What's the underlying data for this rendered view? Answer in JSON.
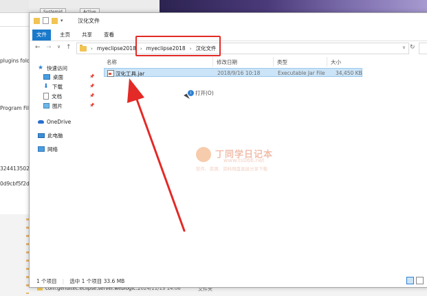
{
  "background": {
    "left_texts": [
      "plugins fold",
      "Program Fil",
      "3244135027",
      "0d9cbf5f2d"
    ],
    "top_buttons": [
      "Systemid",
      "Active"
    ],
    "bottom_row": {
      "name": "com.genuitec.eclipse.server.weblogic...",
      "date": "2024/11/13 14:06",
      "type": "文件夹"
    }
  },
  "window": {
    "title": "汉化文件",
    "tabs": [
      "文件",
      "主页",
      "共享",
      "查看"
    ],
    "active_tab": "文件",
    "breadcrumb": [
      "myeclipse2018",
      "myeclipse2018",
      "汉化文件"
    ]
  },
  "nav": {
    "quick_access": "快速访问",
    "items": [
      "桌面",
      "下载",
      "文档",
      "图片"
    ],
    "onedrive": "OneDrive",
    "this_pc": "此电脑",
    "network": "网络"
  },
  "columns": [
    "名称",
    "修改日期",
    "类型",
    "大小"
  ],
  "files": [
    {
      "name": "汉化工具.jar",
      "modified": "2018/9/16 10:18",
      "type": "Executable Jar File",
      "size": "34,450 KB"
    }
  ],
  "tooltip": "打开(O)",
  "watermark": {
    "title": "丁同学日记本",
    "url": "www.ts066.net",
    "subtitle": "软件、资源、资料网盘直接分享下载"
  },
  "status": {
    "count": "1 个项目",
    "selected": "选中 1 个项目  33.6 MB"
  },
  "colors": {
    "accent": "#1979ca",
    "highlight": "#e32a26",
    "selection": "#cce4f7"
  }
}
